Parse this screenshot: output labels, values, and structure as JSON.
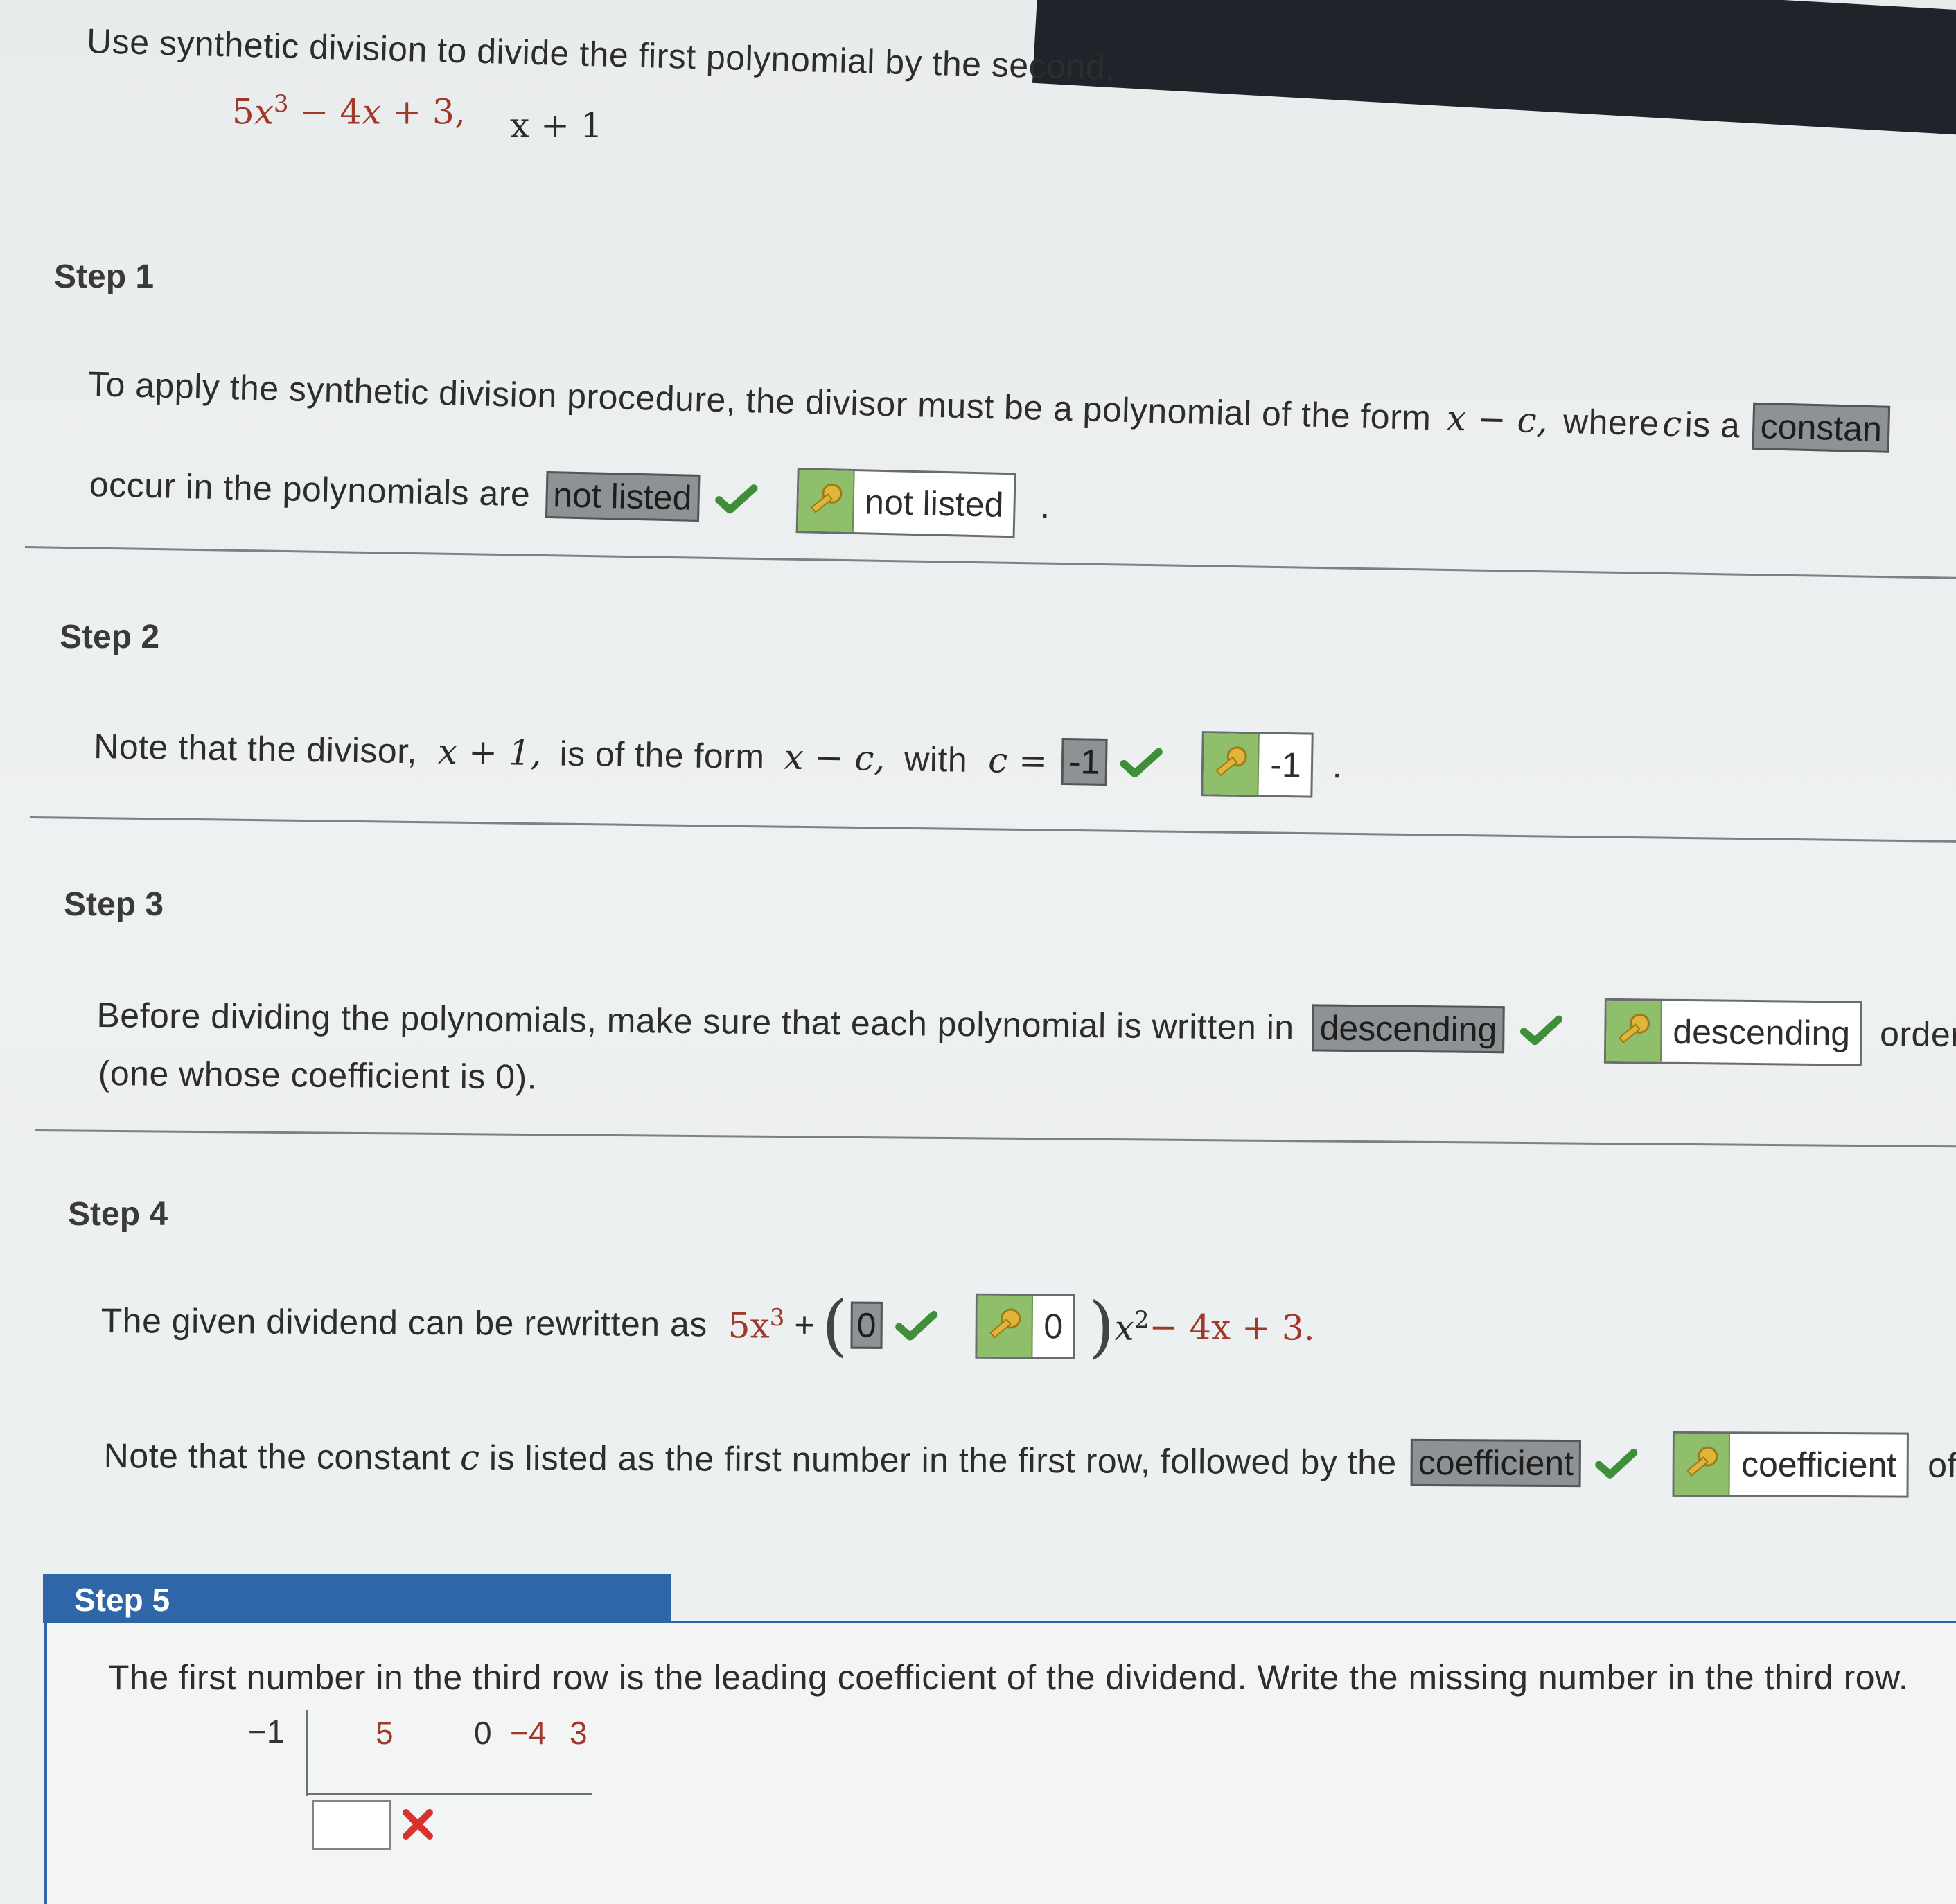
{
  "prompt": {
    "instruction": "Use synthetic division to divide the first polynomial by the second.",
    "dividend_coef": "5",
    "dividend_exp": "3",
    "dividend_rest": " − 4",
    "dividend_tail": " + 3,",
    "divisor": "x + 1"
  },
  "step1": {
    "label": "Step 1",
    "line1": "To apply the synthetic division procedure, the divisor must be a polynomial of the form",
    "form": "x − c,",
    "line1_tail": "where",
    "c_var": "c",
    "is_a": "is a",
    "answer_constant": "constan",
    "line2": "occur in the polynomials are",
    "answer": "not listed",
    "key_answer": "not listed",
    "end": "."
  },
  "step2": {
    "label": "Step 2",
    "text_a": "Note that the divisor,",
    "divisor": "x + 1,",
    "text_b": "is of the form",
    "form": "x − c,",
    "text_c": "with",
    "c_eq": "c =",
    "answer": "-1",
    "key_answer": "-1",
    "end": "."
  },
  "step3": {
    "label": "Step 3",
    "line1": "Before dividing the polynomials, make sure that each polynomial is written in",
    "answer": "descending",
    "key_answer": "descending",
    "tail": "order.",
    "line2": "(one whose coefficient is 0)."
  },
  "step4": {
    "label": "Step 4",
    "line1": "The given dividend can be rewritten as",
    "expr_a": "5x",
    "expr_a_exp": "3",
    "plus": "+",
    "answer": "0",
    "key_answer": "0",
    "expr_b": "x",
    "expr_b_exp": "2",
    "expr_c": " − 4x + 3.",
    "line2": "Note that the constant",
    "c_var": "c",
    "line2_b": "is listed as the first number in the first row, followed by the",
    "answer2": "coefficient",
    "key_answer2": "coefficient",
    "tail2": "of"
  },
  "step5": {
    "label": "Step 5",
    "instruction": "The first number in the third row is the leading coefficient of the dividend. Write the missing number in the third row.",
    "divisor_c": "−1",
    "row1": [
      "5",
      "0",
      "−4",
      "3"
    ]
  },
  "colors": {
    "accent_blue": "#2f66a8",
    "check_green": "#3f8f3a",
    "wrong_red": "#d8322c",
    "answer_box": "#8e9294",
    "key_green": "#8fbf6a"
  },
  "icons": [
    "check-icon",
    "key-icon",
    "x-mark-icon"
  ]
}
